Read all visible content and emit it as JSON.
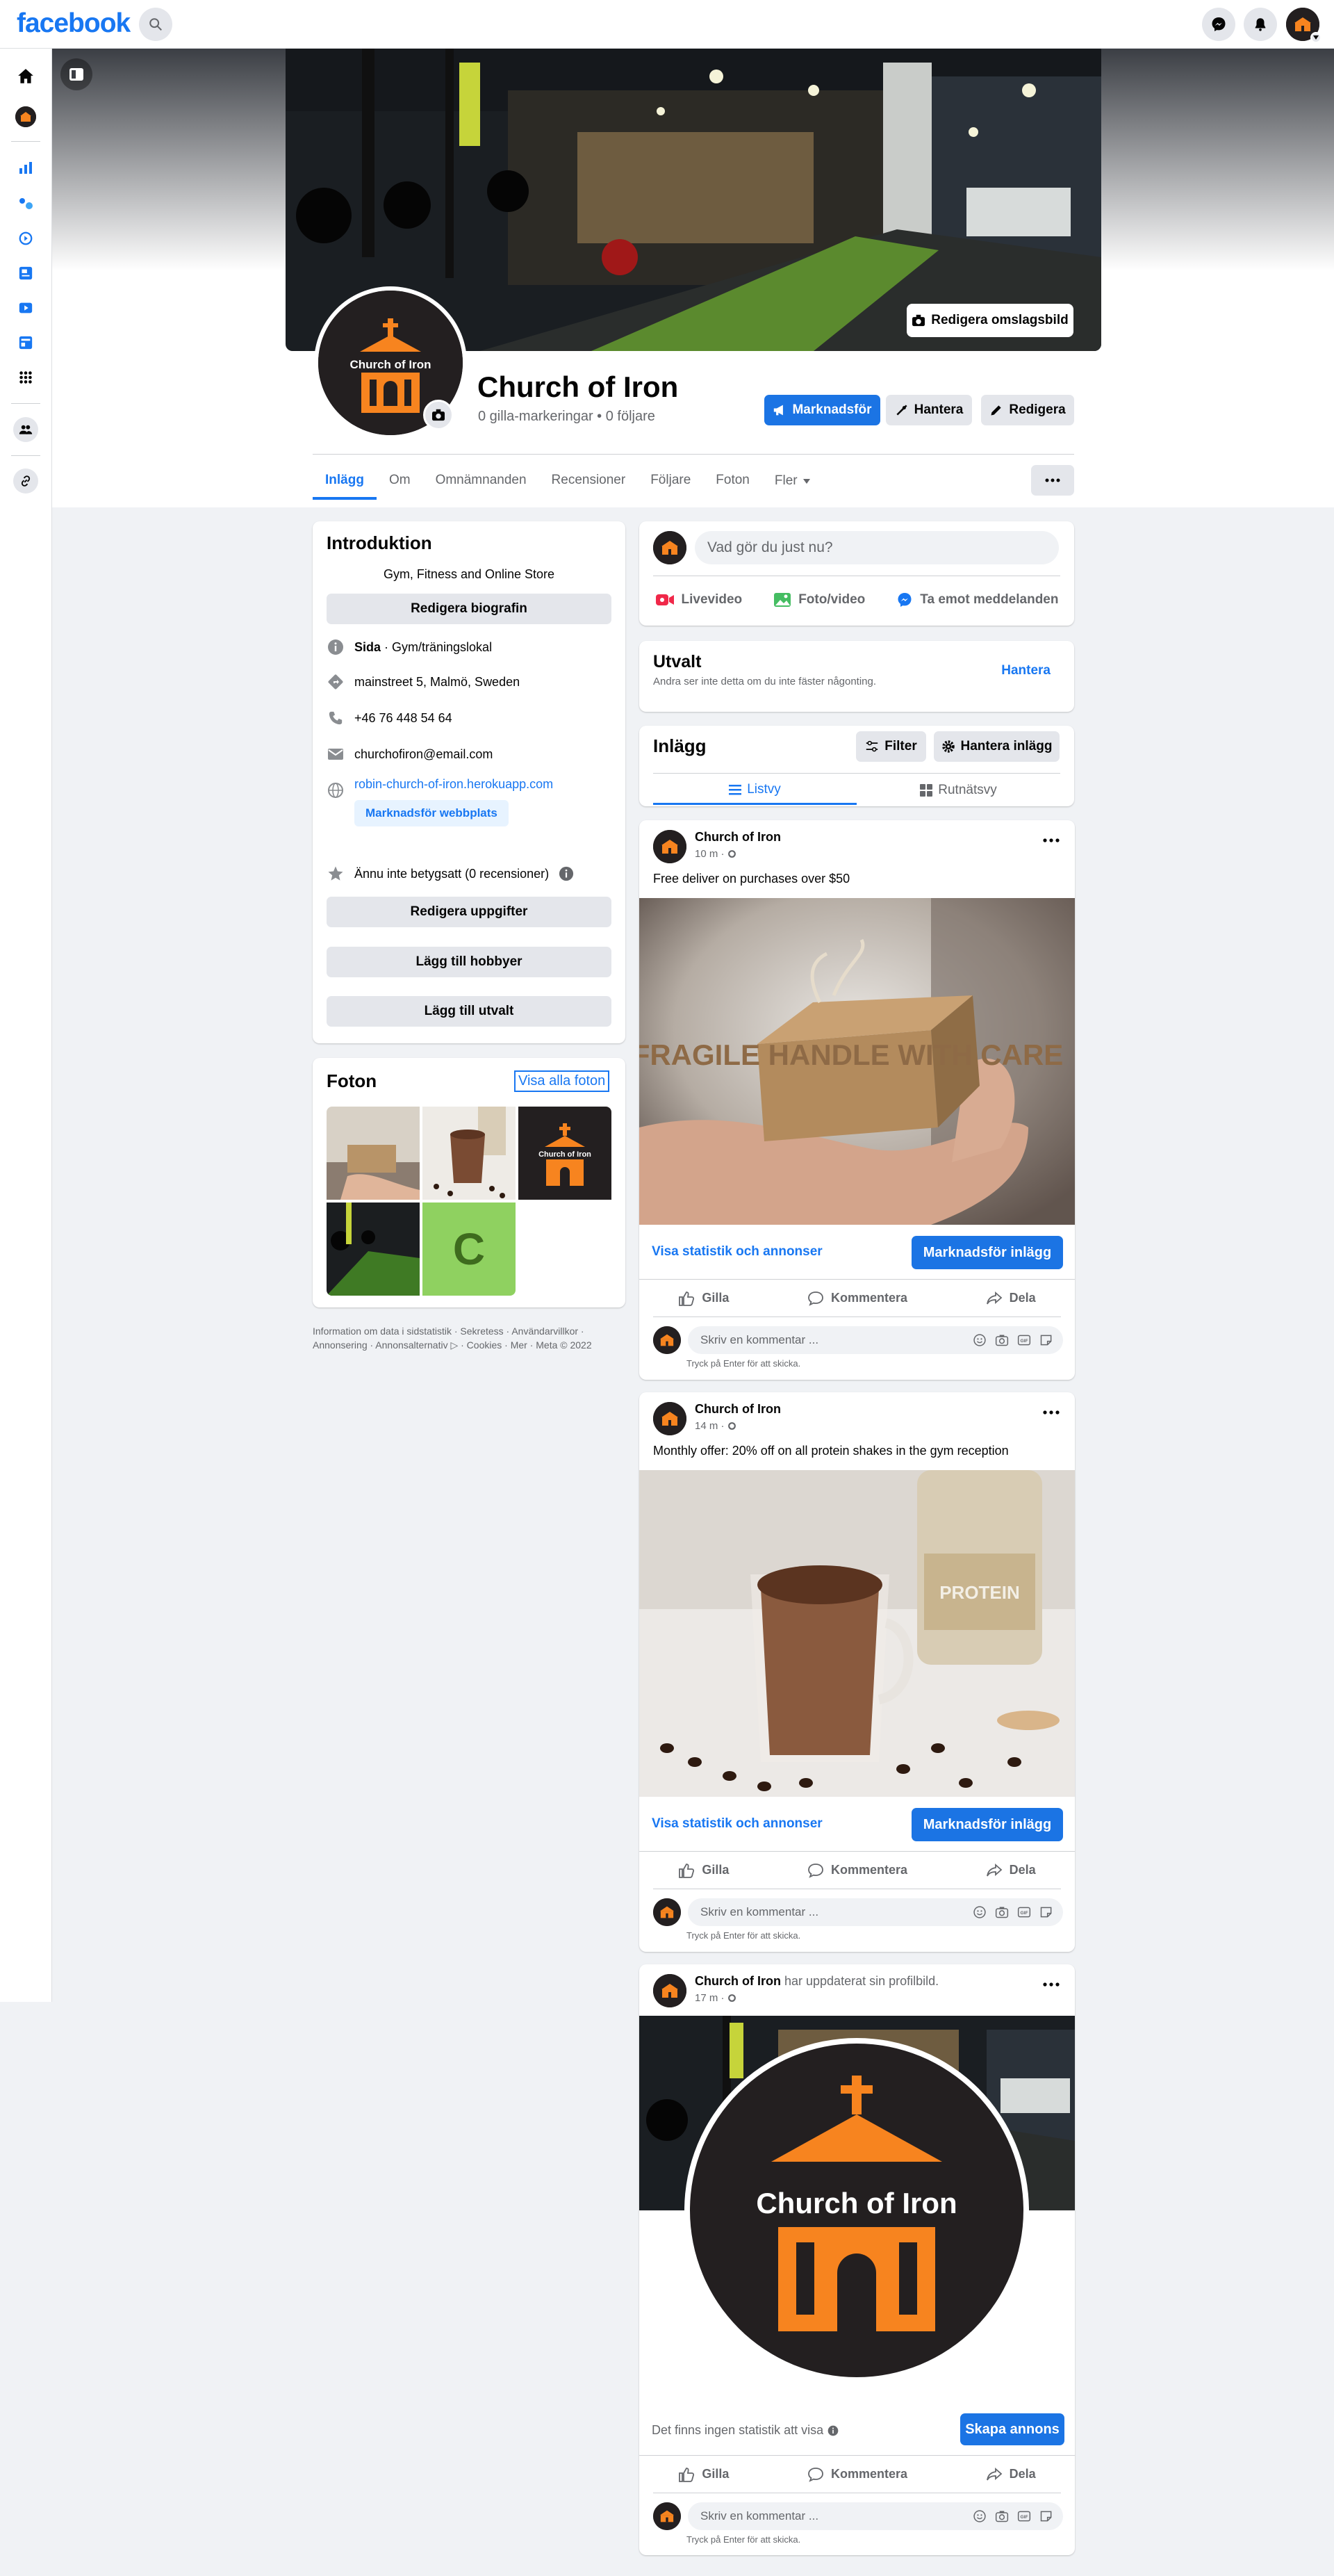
{
  "topbar": {
    "logo": "facebook"
  },
  "profile": {
    "name": "Church of Iron",
    "meta": "0 gilla-markeringar • 0 följare",
    "cover_edit": "Redigera omslagsbild",
    "actions": {
      "promote": "Marknadsför",
      "manage": "Hantera",
      "edit": "Redigera"
    },
    "logo_text": "Church of Iron"
  },
  "tabs": [
    "Inlägg",
    "Om",
    "Omnämnanden",
    "Recensioner",
    "Följare",
    "Foton",
    "Fler"
  ],
  "intro": {
    "title": "Introduktion",
    "bio": "Gym, Fitness and Online Store",
    "edit_bio": "Redigera biografin",
    "page_label": "Sida",
    "category": " · Gym/träningslokal",
    "address": "mainstreet 5, Malmö, Sweden",
    "phone": "+46 76 448 54 64",
    "email": "churchofiron@email.com",
    "website": "robin-church-of-iron.herokuapp.com",
    "promote_site": "Marknadsför webbplats",
    "rating": "Ännu inte betygsatt (0 recensioner)",
    "edit_details": "Redigera uppgifter",
    "add_hobbies": "Lägg till hobbyer",
    "add_featured": "Lägg till utvalt"
  },
  "photos": {
    "title": "Foton",
    "see_all": "Visa alla foton",
    "placeholder_letter": "C"
  },
  "footer": "Information om data i sidstatistik · Sekretess · Användarvillkor · Annonsering · Annonsalternativ ▷ · Cookies · Mer · Meta © 2022",
  "composer": {
    "placeholder": "Vad gör du just nu?",
    "live": "Livevideo",
    "photo": "Foto/video",
    "messages": "Ta emot meddelanden"
  },
  "featured": {
    "title": "Utvalt",
    "desc": "Andra ser inte detta om du inte fäster någonting.",
    "manage": "Hantera"
  },
  "posts_header": {
    "title": "Inlägg",
    "filter": "Filter",
    "manage": "Hantera inlägg",
    "list_view": "Listvy",
    "grid_view": "Rutnätsvy"
  },
  "posts": [
    {
      "author": "Church of Iron",
      "action": "",
      "time": "10 m ·",
      "text": "Free deliver on purchases over $50",
      "stats_text": "Visa statistik och annonser",
      "cta": "Marknadsför inlägg",
      "image_text": "FRAGILE HANDLE WITH CARE"
    },
    {
      "author": "Church of Iron",
      "action": "",
      "time": "14 m ·",
      "text": "Monthly offer: 20% off on all protein shakes in the gym reception",
      "stats_text": "Visa statistik och annonser",
      "cta": "Marknadsför inlägg",
      "image_text": "PROTEIN"
    },
    {
      "author": "Church of Iron",
      "action": " har uppdaterat sin profilbild.",
      "time": "17 m ·",
      "text": "",
      "stats_text": "Det finns ingen statistik att visa",
      "cta": "Skapa annons",
      "image_text": "Church of Iron"
    }
  ],
  "post_actions": {
    "like": "Gilla",
    "comment": "Kommentera",
    "share": "Dela"
  },
  "comment": {
    "placeholder": "Skriv en kommentar ...",
    "hint": "Tryck på Enter för att skicka."
  },
  "colors": {
    "brand": "#1877f2",
    "button_blue": "#1b74e4",
    "logo_orange": "#f7841f",
    "logo_dark": "#231f20"
  }
}
